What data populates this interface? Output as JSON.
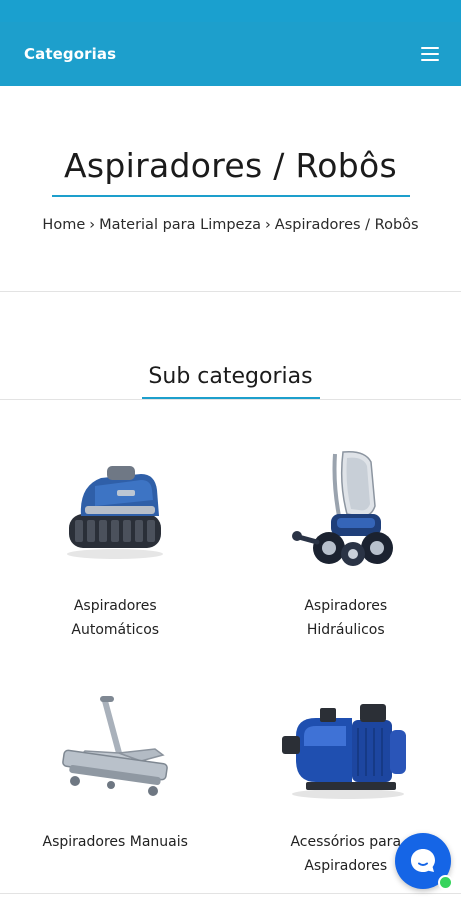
{
  "header": {
    "title": "Categorias",
    "menu_icon": "hamburger-menu-icon"
  },
  "page": {
    "title": "Aspiradores / Robôs",
    "breadcrumb": [
      {
        "label": "Home"
      },
      {
        "label": "Material para Limpeza"
      },
      {
        "label": "Aspiradores / Robôs"
      }
    ],
    "separator": "›"
  },
  "subcategories": {
    "title": "Sub categorias",
    "items": [
      {
        "label": "Aspiradores Automáticos",
        "image": "robotic-pool-cleaner-image"
      },
      {
        "label": "Aspiradores Hidráulicos",
        "image": "hydraulic-pool-cleaner-image"
      },
      {
        "label": "Aspiradores Manuais",
        "image": "manual-pool-vacuum-head-image"
      },
      {
        "label": "Acessórios para Aspiradores",
        "image": "pool-pump-image"
      }
    ]
  },
  "chat": {
    "icon": "chat-bubble-icon",
    "status_color": "#37d45d"
  },
  "colors": {
    "brand": "#1d9fcc",
    "chat": "#1565e6"
  }
}
